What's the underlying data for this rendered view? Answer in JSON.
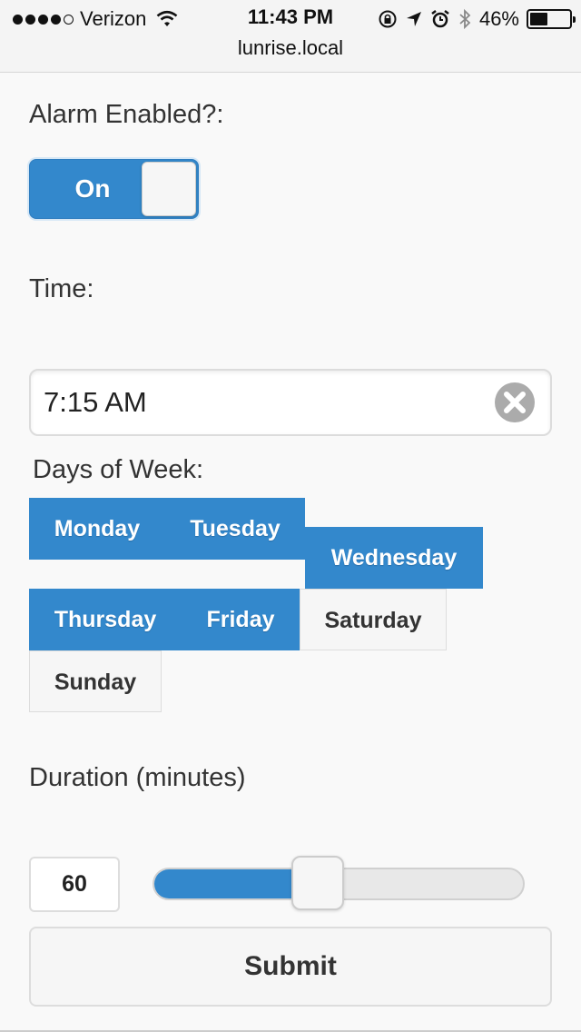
{
  "statusbar": {
    "carrier": "Verizon",
    "time": "11:43 PM",
    "battery": "46%",
    "battery_level": 0.46,
    "url": "lunrise.local"
  },
  "alarm": {
    "label": "Alarm Enabled?:",
    "toggle_text": "On",
    "enabled": true
  },
  "time": {
    "label": "Time:",
    "value": "7:15 AM"
  },
  "days": {
    "label": "Days of Week:",
    "items": [
      {
        "label": "Monday",
        "selected": true
      },
      {
        "label": "Tuesday",
        "selected": true
      },
      {
        "label": "Wednesday",
        "selected": true
      },
      {
        "label": "Thursday",
        "selected": true
      },
      {
        "label": "Friday",
        "selected": true
      },
      {
        "label": "Saturday",
        "selected": false
      },
      {
        "label": "Sunday",
        "selected": false
      }
    ]
  },
  "duration": {
    "label": "Duration (minutes)",
    "value": "60",
    "slider_fraction": 0.42
  },
  "submit_label": "Submit",
  "colors": {
    "accent": "#3388cc",
    "background": "#f9f9f9"
  }
}
